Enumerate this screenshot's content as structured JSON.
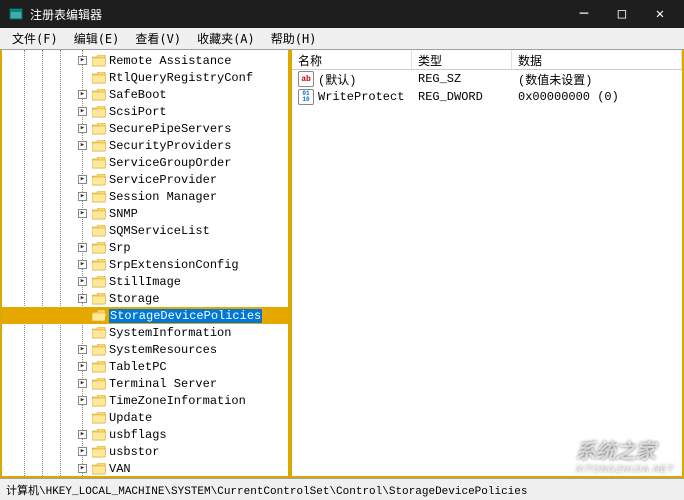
{
  "window": {
    "title": "注册表编辑器"
  },
  "menu": {
    "file": "文件(F)",
    "edit": "编辑(E)",
    "view": "查看(V)",
    "favorites": "收藏夹(A)",
    "help": "帮助(H)"
  },
  "tree": {
    "selected_index": 14,
    "items": [
      {
        "label": "Remote Assistance",
        "expandable": true
      },
      {
        "label": "RtlQueryRegistryConf",
        "expandable": false
      },
      {
        "label": "SafeBoot",
        "expandable": true
      },
      {
        "label": "ScsiPort",
        "expandable": true
      },
      {
        "label": "SecurePipeServers",
        "expandable": true
      },
      {
        "label": "SecurityProviders",
        "expandable": true
      },
      {
        "label": "ServiceGroupOrder",
        "expandable": false
      },
      {
        "label": "ServiceProvider",
        "expandable": true
      },
      {
        "label": "Session Manager",
        "expandable": true
      },
      {
        "label": "SNMP",
        "expandable": true
      },
      {
        "label": "SQMServiceList",
        "expandable": false
      },
      {
        "label": "Srp",
        "expandable": true
      },
      {
        "label": "SrpExtensionConfig",
        "expandable": true
      },
      {
        "label": "StillImage",
        "expandable": true
      },
      {
        "label": "Storage",
        "expandable": true
      },
      {
        "label": "StorageDevicePolicies",
        "expandable": false
      },
      {
        "label": "SystemInformation",
        "expandable": false
      },
      {
        "label": "SystemResources",
        "expandable": true
      },
      {
        "label": "TabletPC",
        "expandable": true
      },
      {
        "label": "Terminal Server",
        "expandable": true
      },
      {
        "label": "TimeZoneInformation",
        "expandable": true
      },
      {
        "label": "Update",
        "expandable": false
      },
      {
        "label": "usbflags",
        "expandable": true
      },
      {
        "label": "usbstor",
        "expandable": true
      },
      {
        "label": "VAN",
        "expandable": true
      }
    ]
  },
  "list": {
    "headers": {
      "name": "名称",
      "type": "类型",
      "data": "数据"
    },
    "rows": [
      {
        "icon": "sz",
        "icon_text": "ab",
        "name": "(默认)",
        "type": "REG_SZ",
        "data": "(数值未设置)"
      },
      {
        "icon": "dw",
        "icon_text": "01\n10",
        "name": "WriteProtect",
        "type": "REG_DWORD",
        "data": "0x00000000 (0)"
      }
    ]
  },
  "statusbar": {
    "path": "计算机\\HKEY_LOCAL_MACHINE\\SYSTEM\\CurrentControlSet\\Control\\StorageDevicePolicies"
  },
  "watermark": {
    "text": "系统之家",
    "url": "XITONGZHIJIA.NET"
  }
}
